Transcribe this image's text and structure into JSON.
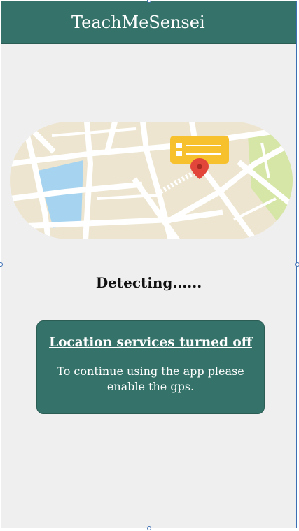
{
  "header": {
    "title": "TeachMeSensei"
  },
  "status": {
    "text": "Detecting......"
  },
  "alert": {
    "title": "Location services turned off",
    "message": "To continue using the app please enable the gps."
  },
  "icons": {
    "map": "map-illustration",
    "pin": "map-pin-icon"
  },
  "colors": {
    "header": "#35736a",
    "card": "#35736a",
    "background": "#efefef",
    "pin": "#e2463a",
    "popup": "#f7c12e"
  }
}
